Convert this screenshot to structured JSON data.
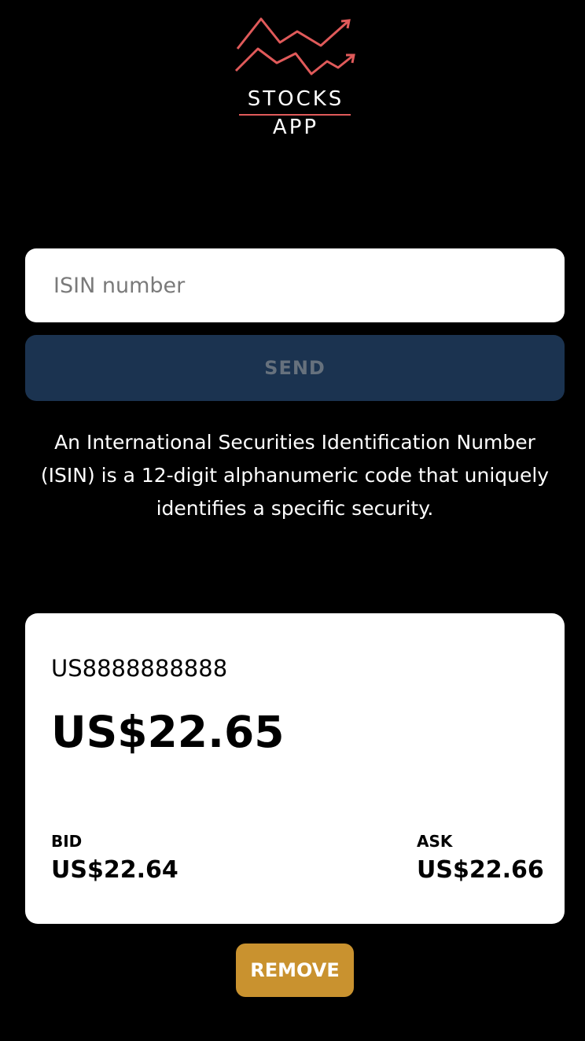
{
  "app": {
    "logo_line1": "STOCKS",
    "logo_line2": "APP",
    "logo_accent_color": "#e05a5a"
  },
  "form": {
    "isin_placeholder": "ISIN number",
    "isin_value": "",
    "send_label": "SEND",
    "send_bg_color": "#1b3350"
  },
  "description": "An International Securities Identification Number (ISIN) is a 12-digit alphanumeric code that uniquely identifies a specific security.",
  "quote": {
    "isin": "US8888888888",
    "price": "US$22.65",
    "bid_label": "BID",
    "bid_value": "US$22.64",
    "ask_label": "ASK",
    "ask_value": "US$22.66"
  },
  "remove_button": {
    "label": "REMOVE",
    "bg_color": "#c9922f"
  }
}
